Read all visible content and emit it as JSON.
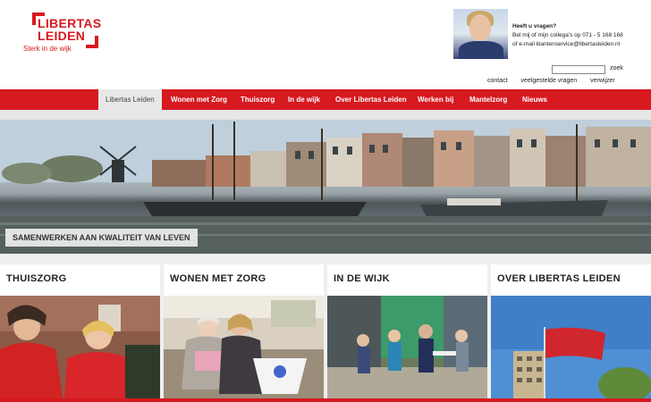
{
  "brand": {
    "name_line1": "LIBERTAS",
    "name_line2": "LEIDEN",
    "tagline": "Sterk in de wijk",
    "accent_color": "#d71920"
  },
  "contact": {
    "question": "Heeft u vragen?",
    "line1": "Bel mij of mijn collega's op 071 - 5 168 168",
    "line2": "of e-mail klantenservice@libertasleiden.nl"
  },
  "search": {
    "placeholder": "",
    "button_label": "zoek"
  },
  "toplinks": [
    "contact",
    "veelgestelde vragen",
    "verwijzer"
  ],
  "nav": {
    "items": [
      {
        "label": "Libertas Leiden",
        "active": true
      },
      {
        "label": "Wonen met Zorg"
      },
      {
        "label": "Thuiszorg"
      },
      {
        "label": "In de wijk"
      },
      {
        "label": "Over Libertas Leiden"
      },
      {
        "label": "Werken bij"
      },
      {
        "label": "Mantelzorg"
      },
      {
        "label": "Nieuws"
      }
    ]
  },
  "hero": {
    "caption": "SAMENWERKEN AAN KWALITEIT VAN LEVEN",
    "image": "canal-windmill-boats-photo"
  },
  "tiles": [
    {
      "title": "THUISZORG",
      "image": "care-workers-red-jackets-photo"
    },
    {
      "title": "WONEN MET ZORG",
      "image": "elderly-woman-caregiver-photo"
    },
    {
      "title": "IN DE WIJK",
      "image": "neighborhood-activity-photo"
    },
    {
      "title": "OVER LIBERTAS LEIDEN",
      "image": "flag-building-photo"
    }
  ]
}
